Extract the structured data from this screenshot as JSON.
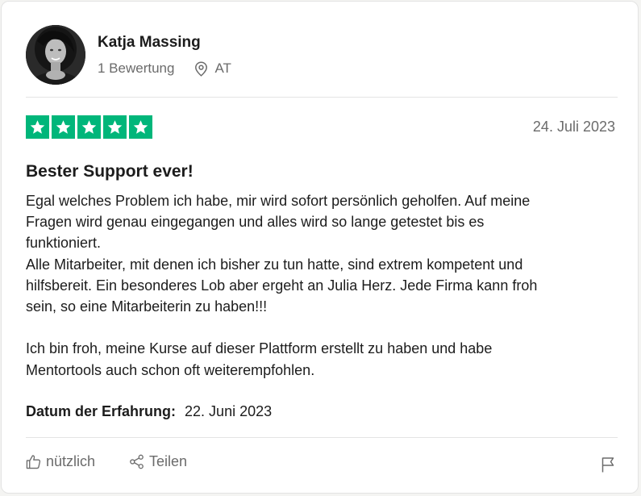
{
  "reviewer": {
    "name": "Katja Massing",
    "review_count": "1 Bewertung",
    "country": "AT"
  },
  "review": {
    "rating": 5,
    "date": "24. Juli 2023",
    "title": "Bester Support ever!",
    "lines": [
      "Egal welches Problem ich habe, mir wird sofort persönlich geholfen. Auf meine",
      "Fragen wird genau eingegangen und alles wird so lange getestet bis es",
      "funktioniert.",
      "Alle Mitarbeiter, mit denen ich bisher zu tun hatte, sind extrem kompetent und",
      "hilfsbereit. Ein besonderes Lob aber ergeht an Julia Herz. Jede Firma kann froh",
      "sein, so eine Mitarbeiterin zu haben!!!",
      "",
      "Ich bin froh, meine Kurse auf dieser Plattform erstellt zu haben und habe",
      "Mentortools auch schon oft weiterempfohlen."
    ],
    "experience_label": "Datum der Erfahrung:",
    "experience_date": "22. Juni 2023"
  },
  "actions": {
    "useful_label": "nützlich",
    "share_label": "Teilen"
  },
  "colors": {
    "star_green": "#00b67a",
    "muted_text": "#6b6b6b"
  },
  "icons": {
    "location": "location-pin-icon",
    "useful": "thumbs-up-icon",
    "share": "share-icon",
    "report": "flag-icon",
    "star": "star-icon"
  }
}
